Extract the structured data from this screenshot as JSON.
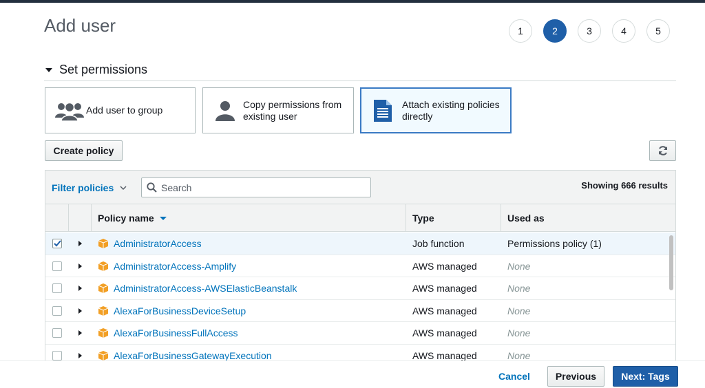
{
  "page": {
    "title": "Add user"
  },
  "steps": [
    "1",
    "2",
    "3",
    "4",
    "5"
  ],
  "active_step": "2",
  "section": {
    "title": "Set permissions"
  },
  "options": [
    {
      "label": "Add user to group",
      "icon": "users-group-icon",
      "selected": false
    },
    {
      "label": "Copy permissions from existing user",
      "icon": "user-icon",
      "selected": false
    },
    {
      "label": "Attach existing policies directly",
      "icon": "document-icon",
      "selected": true
    }
  ],
  "toolbar": {
    "create_policy_label": "Create policy",
    "refresh_icon": "refresh-icon"
  },
  "filter": {
    "label": "Filter policies",
    "search_placeholder": "Search",
    "results_text": "Showing 666 results"
  },
  "table": {
    "columns": [
      "Policy name",
      "Type",
      "Used as"
    ],
    "rows": [
      {
        "name": "AdministratorAccess",
        "type": "Job function",
        "used_as": "Permissions policy (1)",
        "checked": true
      },
      {
        "name": "AdministratorAccess-Amplify",
        "type": "AWS managed",
        "used_as": "None",
        "checked": false
      },
      {
        "name": "AdministratorAccess-AWSElasticBeanstalk",
        "type": "AWS managed",
        "used_as": "None",
        "checked": false
      },
      {
        "name": "AlexaForBusinessDeviceSetup",
        "type": "AWS managed",
        "used_as": "None",
        "checked": false
      },
      {
        "name": "AlexaForBusinessFullAccess",
        "type": "AWS managed",
        "used_as": "None",
        "checked": false
      },
      {
        "name": "AlexaForBusinessGatewayExecution",
        "type": "AWS managed",
        "used_as": "None",
        "checked": false
      }
    ]
  },
  "footer": {
    "cancel_label": "Cancel",
    "previous_label": "Previous",
    "next_label": "Next: Tags"
  },
  "colors": {
    "accent": "#1f5fa8",
    "link": "#0073bb",
    "policy_icon": "#f29f25",
    "selected_row": "#eef6fc"
  }
}
